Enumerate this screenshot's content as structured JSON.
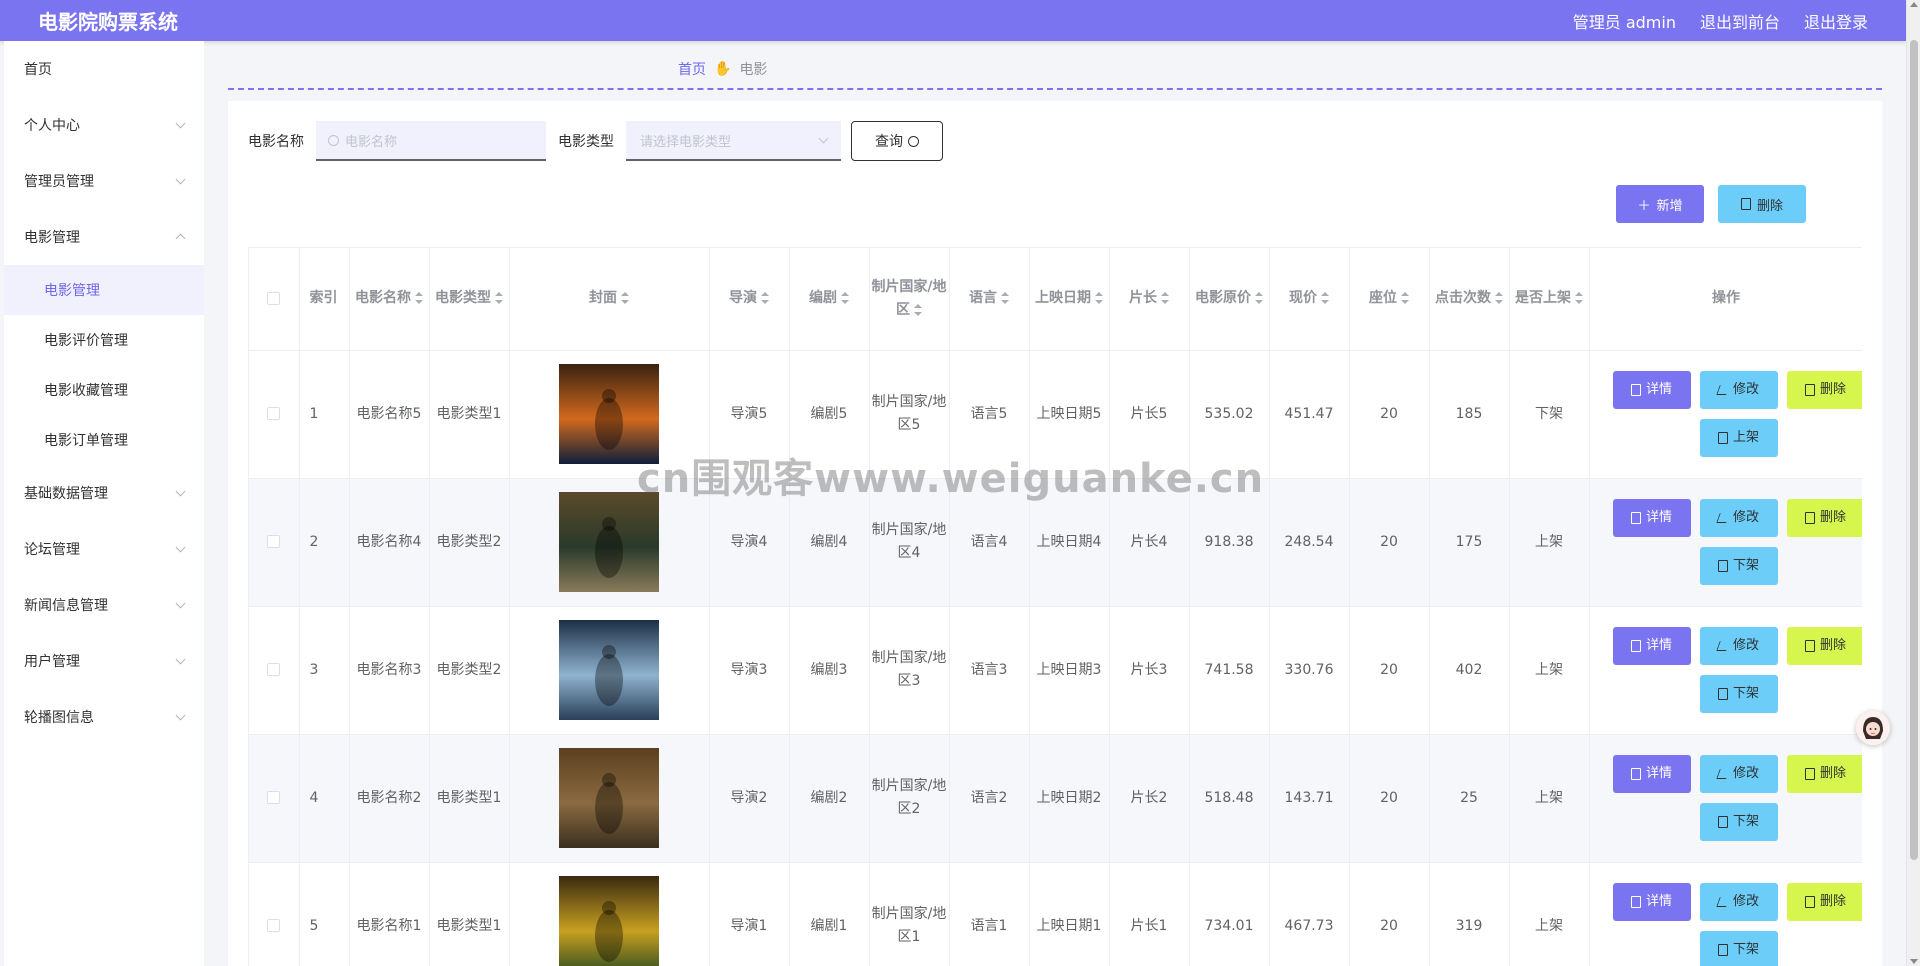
{
  "header": {
    "title": "电影院购票系统",
    "admin_label": "管理员 admin",
    "to_front_label": "退出到前台",
    "logout_label": "退出登录"
  },
  "sidebar": {
    "items": [
      {
        "label": "首页"
      },
      {
        "label": "个人中心"
      },
      {
        "label": "管理员管理"
      },
      {
        "label": "电影管理",
        "children": [
          "电影管理",
          "电影评价管理",
          "电影收藏管理",
          "电影订单管理"
        ]
      },
      {
        "label": "基础数据管理"
      },
      {
        "label": "论坛管理"
      },
      {
        "label": "新闻信息管理"
      },
      {
        "label": "用户管理"
      },
      {
        "label": "轮播图信息"
      }
    ]
  },
  "breadcrumb": {
    "home": "首页",
    "current": "电影"
  },
  "search": {
    "name_label": "电影名称",
    "name_placeholder": "电影名称",
    "type_label": "电影类型",
    "type_placeholder": "请选择电影类型",
    "query_label": "查询"
  },
  "actions": {
    "add_label": "新增",
    "delete_label": "删除"
  },
  "table": {
    "headers": [
      "索引",
      "电影名称",
      "电影类型",
      "封面",
      "导演",
      "编剧",
      "制片国家/地区",
      "语言",
      "上映日期",
      "片长",
      "电影原价",
      "现价",
      "座位",
      "点击次数",
      "是否上架",
      "操作"
    ],
    "rows": [
      {
        "index": "1",
        "name": "电影名称5",
        "type": "电影类型1",
        "director": "导演5",
        "writer": "编剧5",
        "country": "制片国家/地区5",
        "language": "语言5",
        "date": "上映日期5",
        "length": "片长5",
        "orig_price": "535.02",
        "price": "451.47",
        "seats": "20",
        "clicks": "185",
        "on_shelf": "下架",
        "shelf_btn": "上架",
        "poster_colors": [
          "#3a2210",
          "#d2691e",
          "#0e1f3a"
        ]
      },
      {
        "index": "2",
        "name": "电影名称4",
        "type": "电影类型2",
        "director": "导演4",
        "writer": "编剧4",
        "country": "制片国家/地区4",
        "language": "语言4",
        "date": "上映日期4",
        "length": "片长4",
        "orig_price": "918.38",
        "price": "248.54",
        "seats": "20",
        "clicks": "175",
        "on_shelf": "上架",
        "shelf_btn": "下架",
        "poster_colors": [
          "#5a4a2a",
          "#2a3a2a",
          "#8a7a5a"
        ]
      },
      {
        "index": "3",
        "name": "电影名称3",
        "type": "电影类型2",
        "director": "导演3",
        "writer": "编剧3",
        "country": "制片国家/地区3",
        "language": "语言3",
        "date": "上映日期3",
        "length": "片长3",
        "orig_price": "741.58",
        "price": "330.76",
        "seats": "20",
        "clicks": "402",
        "on_shelf": "上架",
        "shelf_btn": "下架",
        "poster_colors": [
          "#1d2f45",
          "#8fb3cf",
          "#2a4058"
        ]
      },
      {
        "index": "4",
        "name": "电影名称2",
        "type": "电影类型1",
        "director": "导演2",
        "writer": "编剧2",
        "country": "制片国家/地区2",
        "language": "语言2",
        "date": "上映日期2",
        "length": "片长2",
        "orig_price": "518.48",
        "price": "143.71",
        "seats": "20",
        "clicks": "25",
        "on_shelf": "上架",
        "shelf_btn": "下架",
        "poster_colors": [
          "#5a4020",
          "#8a6a40",
          "#3a3020"
        ]
      },
      {
        "index": "5",
        "name": "电影名称1",
        "type": "电影类型1",
        "director": "导演1",
        "writer": "编剧1",
        "country": "制片国家/地区1",
        "language": "语言1",
        "date": "上映日期1",
        "length": "片长1",
        "orig_price": "734.01",
        "price": "467.73",
        "seats": "20",
        "clicks": "319",
        "on_shelf": "上架",
        "shelf_btn": "下架",
        "poster_colors": [
          "#3a2a10",
          "#c8a020",
          "#2a4a20"
        ]
      }
    ],
    "op_labels": {
      "detail": "详情",
      "edit": "修改",
      "delete": "删除"
    }
  },
  "watermark": "cn围观客www.weiguanke.cn",
  "colors": {
    "primary": "#7b74f0",
    "info": "#6ccdf8",
    "warning": "#d6f54d"
  }
}
